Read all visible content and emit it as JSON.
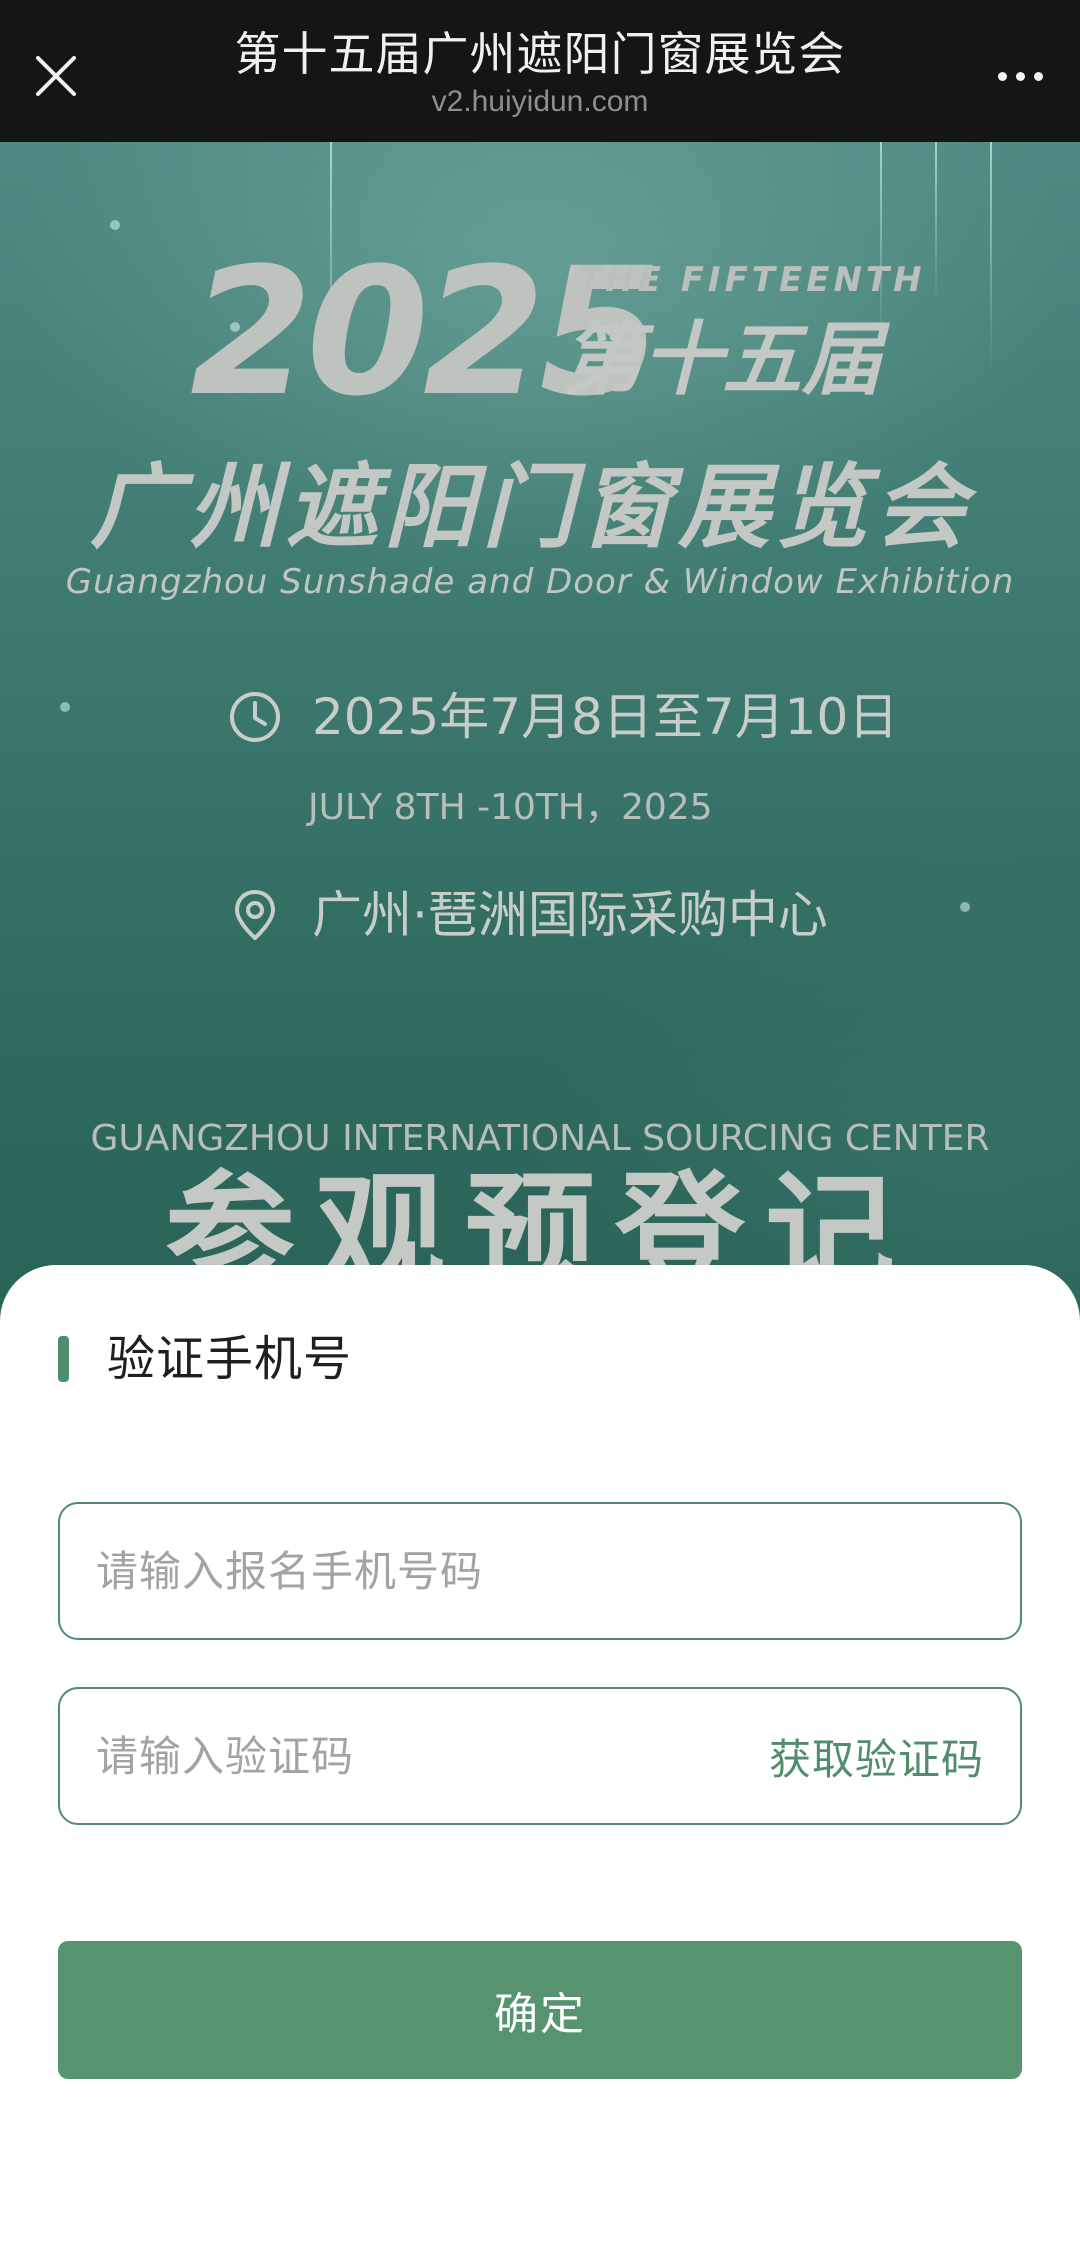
{
  "browser": {
    "title": "第十五届广州遮阳门窗展览会",
    "url": "v2.huiyidun.com",
    "close_icon": "close-icon",
    "more_icon": "more-icon"
  },
  "banner": {
    "year": "2025",
    "edition_en": "THE FIFTEENTH",
    "edition_cn": "第十五届",
    "expo_name_cn": "广州遮阳门窗展览会",
    "expo_name_en": "Guangzhou Sunshade and Door & Window Exhibition",
    "date_cn": "2025年7月8日至7月10日",
    "date_en": "JULY 8TH -10TH，2025",
    "location_cn": "广州·琶洲国际采购中心",
    "location_en": "GUANGZHOU INTERNATIONAL SOURCING CENTER",
    "register_title": "参观预登记",
    "clock_icon": "clock-icon",
    "pin_icon": "location-pin-icon"
  },
  "form": {
    "heading": "验证手机号",
    "phone_placeholder": "请输入报名手机号码",
    "phone_value": "",
    "code_placeholder": "请输入验证码",
    "code_value": "",
    "get_code_label": "获取验证码",
    "confirm_label": "确定",
    "accent_color": "#4f8d6c"
  }
}
